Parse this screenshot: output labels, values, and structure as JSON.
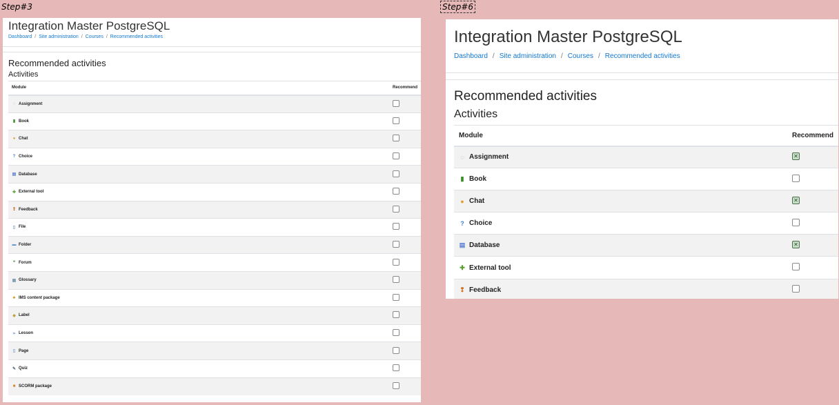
{
  "steps": {
    "left_label": "Step#3",
    "right_label": "Step#6"
  },
  "site": {
    "title": "Integration Master PostgreSQL"
  },
  "breadcrumb": [
    "Dashboard",
    "Site administration",
    "Courses",
    "Recommended activities"
  ],
  "page": {
    "heading": "Recommended activities",
    "subheading": "Activities"
  },
  "table": {
    "col_module": "Module",
    "col_recommend": "Recommend"
  },
  "left_modules": [
    {
      "name": "Assignment",
      "icon": "assignment-icon",
      "glyph": "◌",
      "color": "#8aa0b8",
      "checked": false
    },
    {
      "name": "Book",
      "icon": "book-icon",
      "glyph": "▮",
      "color": "#3a8f2a",
      "checked": false
    },
    {
      "name": "Chat",
      "icon": "chat-icon",
      "glyph": "●",
      "color": "#e0a030",
      "checked": false
    },
    {
      "name": "Choice",
      "icon": "choice-icon",
      "glyph": "?",
      "color": "#3c7fd0",
      "checked": false
    },
    {
      "name": "Database",
      "icon": "database-icon",
      "glyph": "▤",
      "color": "#5a7fd0",
      "checked": false
    },
    {
      "name": "External tool",
      "icon": "external-tool-icon",
      "glyph": "✚",
      "color": "#5aa030",
      "checked": false
    },
    {
      "name": "Feedback",
      "icon": "feedback-icon",
      "glyph": "❢",
      "color": "#d07020",
      "checked": false
    },
    {
      "name": "File",
      "icon": "file-icon",
      "glyph": "▯",
      "color": "#7aa0d0",
      "checked": false
    },
    {
      "name": "Folder",
      "icon": "folder-icon",
      "glyph": "▬",
      "color": "#5a8fd0",
      "checked": false
    },
    {
      "name": "Forum",
      "icon": "forum-icon",
      "glyph": "❝",
      "color": "#5aa050",
      "checked": false
    },
    {
      "name": "Glossary",
      "icon": "glossary-icon",
      "glyph": "▦",
      "color": "#7a9ab0",
      "checked": false
    },
    {
      "name": "IMS content package",
      "icon": "ims-package-icon",
      "glyph": "♣",
      "color": "#d09020",
      "checked": false
    },
    {
      "name": "Label",
      "icon": "label-icon",
      "glyph": "◆",
      "color": "#c0a040",
      "checked": false
    },
    {
      "name": "Lesson",
      "icon": "lesson-icon",
      "glyph": "➢",
      "color": "#7a9ad0",
      "checked": false
    },
    {
      "name": "Page",
      "icon": "page-icon",
      "glyph": "▯",
      "color": "#7aa0d0",
      "checked": false
    },
    {
      "name": "Quiz",
      "icon": "quiz-icon",
      "glyph": "✎",
      "color": "#607090",
      "checked": false
    },
    {
      "name": "SCORM package",
      "icon": "scorm-package-icon",
      "glyph": "■",
      "color": "#d08020",
      "checked": false
    }
  ],
  "right_modules": [
    {
      "name": "Assignment",
      "icon": "assignment-icon",
      "glyph": "◌",
      "color": "#8aa0b8",
      "checked": true
    },
    {
      "name": "Book",
      "icon": "book-icon",
      "glyph": "▮",
      "color": "#3a8f2a",
      "checked": false
    },
    {
      "name": "Chat",
      "icon": "chat-icon",
      "glyph": "●",
      "color": "#e0a030",
      "checked": true
    },
    {
      "name": "Choice",
      "icon": "choice-icon",
      "glyph": "?",
      "color": "#3c7fd0",
      "checked": false
    },
    {
      "name": "Database",
      "icon": "database-icon",
      "glyph": "▤",
      "color": "#5a7fd0",
      "checked": true
    },
    {
      "name": "External tool",
      "icon": "external-tool-icon",
      "glyph": "✚",
      "color": "#5aa030",
      "checked": false
    },
    {
      "name": "Feedback",
      "icon": "feedback-icon",
      "glyph": "❢",
      "color": "#d07020",
      "checked": false
    }
  ]
}
